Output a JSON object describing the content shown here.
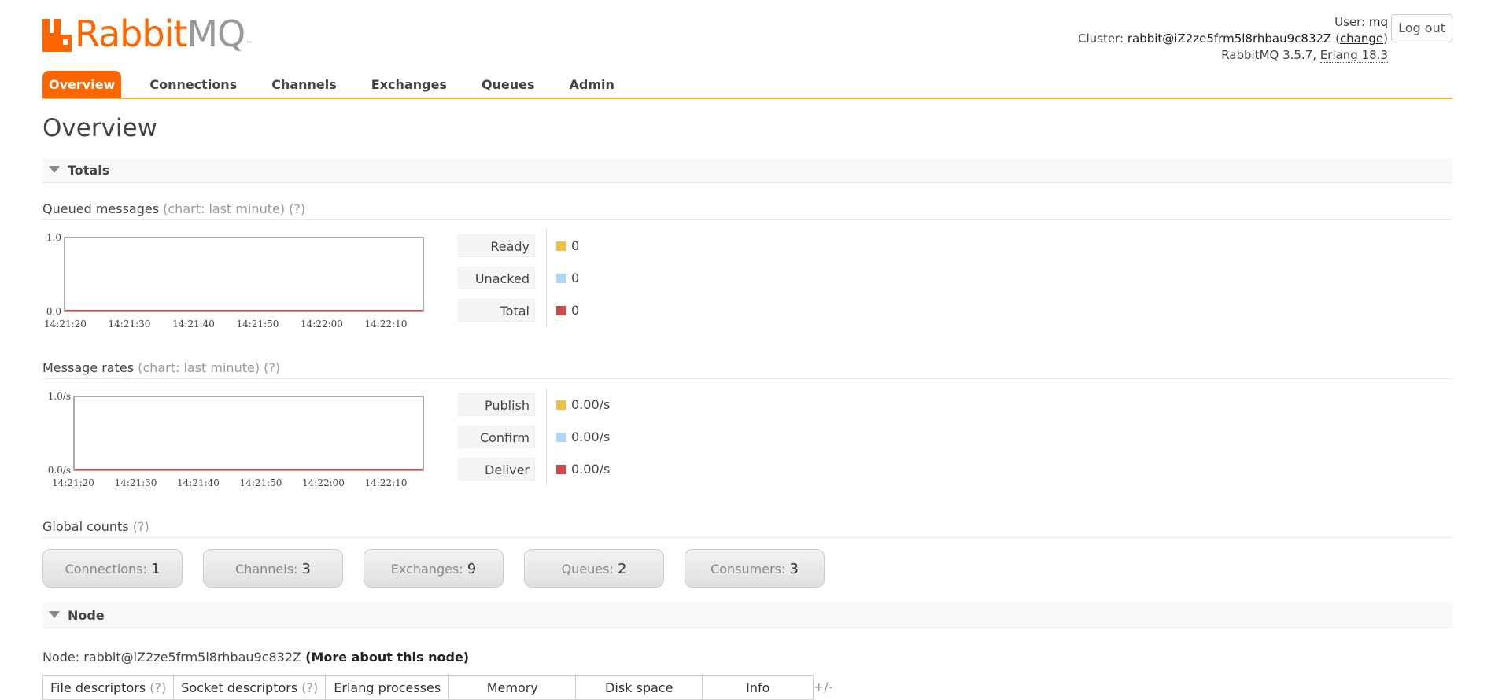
{
  "brand": {
    "name_rabbit": "Rabbit",
    "name_mq": "MQ",
    "trademark": "™",
    "color_orange": "#ff6600",
    "color_grey": "#999999"
  },
  "header": {
    "user_label": "User:",
    "user_value": "mq",
    "cluster_label": "Cluster:",
    "cluster_value": "rabbit@iZ2ze5frm5l8rhbau9c832Z",
    "change_link": "change",
    "version_text": "RabbitMQ 3.5.7,",
    "erlang_text": "Erlang 18.3",
    "logout_label": "Log out"
  },
  "tabs": [
    {
      "label": "Overview",
      "active": true
    },
    {
      "label": "Connections"
    },
    {
      "label": "Channels"
    },
    {
      "label": "Exchanges"
    },
    {
      "label": "Queues"
    },
    {
      "label": "Admin"
    }
  ],
  "page_title": "Overview",
  "totals": {
    "section_label": "Totals",
    "queued": {
      "title": "Queued messages",
      "hint": "(chart: last minute)",
      "help": "(?)",
      "legend": [
        {
          "label": "Ready",
          "value": "0",
          "color": "#edc240"
        },
        {
          "label": "Unacked",
          "value": "0",
          "color": "#afd8f8"
        },
        {
          "label": "Total",
          "value": "0",
          "color": "#cb4b4b"
        }
      ]
    },
    "rates": {
      "title": "Message rates",
      "hint": "(chart: last minute)",
      "help": "(?)",
      "legend": [
        {
          "label": "Publish",
          "value": "0.00/s",
          "color": "#edc240"
        },
        {
          "label": "Confirm",
          "value": "0.00/s",
          "color": "#afd8f8"
        },
        {
          "label": "Deliver",
          "value": "0.00/s",
          "color": "#cb4b4b"
        }
      ]
    },
    "global": {
      "title": "Global counts",
      "help": "(?)",
      "items": [
        {
          "label": "Connections:",
          "value": "1"
        },
        {
          "label": "Channels:",
          "value": "3"
        },
        {
          "label": "Exchanges:",
          "value": "9"
        },
        {
          "label": "Queues:",
          "value": "2"
        },
        {
          "label": "Consumers:",
          "value": "3"
        }
      ]
    }
  },
  "node": {
    "section_label": "Node",
    "line_label": "Node: rabbit@iZ2ze5frm5l8rhbau9c832Z",
    "more_link": "(More about this node)",
    "columns": [
      {
        "label": "File descriptors",
        "help": "(?)"
      },
      {
        "label": "Socket descriptors",
        "help": "(?)"
      },
      {
        "label": "Erlang processes"
      },
      {
        "label": "Memory"
      },
      {
        "label": "Disk space"
      },
      {
        "label": "Info"
      }
    ],
    "toggle": "+/-"
  },
  "chart_data": [
    {
      "type": "line",
      "title": "Queued messages",
      "x": [
        "14:21:20",
        "14:21:30",
        "14:21:40",
        "14:21:50",
        "14:22:00",
        "14:22:10"
      ],
      "y_tick_labels": [
        "0.0",
        "1.0"
      ],
      "ylim": [
        0,
        1
      ],
      "series": [
        {
          "name": "Ready",
          "values": [
            0,
            0,
            0,
            0,
            0,
            0
          ],
          "color": "#edc240"
        },
        {
          "name": "Unacked",
          "values": [
            0,
            0,
            0,
            0,
            0,
            0
          ],
          "color": "#afd8f8"
        },
        {
          "name": "Total",
          "values": [
            0,
            0,
            0,
            0,
            0,
            0
          ],
          "color": "#cb4b4b"
        }
      ],
      "grid": false
    },
    {
      "type": "line",
      "title": "Message rates",
      "x": [
        "14:21:20",
        "14:21:30",
        "14:21:40",
        "14:21:50",
        "14:22:00",
        "14:22:10"
      ],
      "y_tick_labels": [
        "0.0/s",
        "1.0/s"
      ],
      "ylim": [
        0,
        1
      ],
      "series": [
        {
          "name": "Publish",
          "values": [
            0,
            0,
            0,
            0,
            0,
            0
          ],
          "color": "#edc240"
        },
        {
          "name": "Confirm",
          "values": [
            0,
            0,
            0,
            0,
            0,
            0
          ],
          "color": "#afd8f8"
        },
        {
          "name": "Deliver",
          "values": [
            0,
            0,
            0,
            0,
            0,
            0
          ],
          "color": "#cb4b4b"
        }
      ],
      "grid": false
    }
  ]
}
